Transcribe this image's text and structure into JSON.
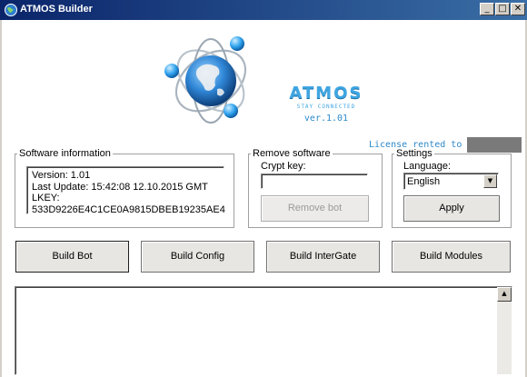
{
  "window": {
    "title": "ATMOS Builder",
    "minimize_glyph": "_",
    "maximize_glyph": "□",
    "close_glyph": "✕"
  },
  "brand": {
    "name": "ATMOS",
    "tagline": "STAY CONNECTED",
    "version": "ver.1.01",
    "license_label": "License rented to"
  },
  "software_info": {
    "legend": "Software information",
    "lines": [
      "Version: 1.01",
      "Last Update: 15:42:08 12.10.2015 GMT",
      "LKEY: 533D9226E4C1CE0A9815DBEB19235AE4"
    ]
  },
  "remove_software": {
    "legend": "Remove software",
    "crypt_key_label": "Crypt key:",
    "crypt_key_value": "",
    "remove_button": "Remove bot"
  },
  "settings": {
    "legend": "Settings",
    "language_label": "Language:",
    "language_value": "English",
    "apply_button": "Apply"
  },
  "build_buttons": [
    "Build Bot",
    "Build Config",
    "Build InterGate",
    "Build Modules"
  ],
  "log": {
    "scroll_up_glyph": "▲",
    "content": ""
  },
  "icons": {
    "app": "globe-icon",
    "logo": "globe-orbit-logo",
    "dropdown": "chevron-down-icon",
    "scroll_up": "arrow-up-icon"
  },
  "colors": {
    "titlebar_start": "#0a246a",
    "titlebar_end": "#3a6ea5",
    "brand": "#3fa6e2",
    "brand_dark": "#2c88c9",
    "redaction": "#7a7a7a"
  }
}
